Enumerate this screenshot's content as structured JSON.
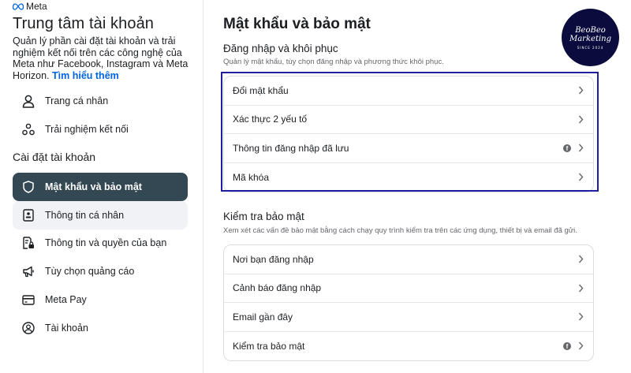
{
  "brand": {
    "name": "Meta",
    "logo_color": "#0064e0"
  },
  "sidebar": {
    "title": "Trung tâm tài khoản",
    "description": "Quản lý phần cài đặt tài khoản và trải nghiệm kết nối trên các công nghệ của Meta như Facebook, Instagram và Meta Horizon.",
    "learn_more": "Tìm hiểu thêm",
    "top_items": [
      {
        "label": "Trang cá nhân",
        "icon": "person-icon"
      },
      {
        "label": "Trải nghiệm kết nối",
        "icon": "connected-icon"
      }
    ],
    "section_label": "Cài đặt tài khoản",
    "settings_items": [
      {
        "label": "Mật khẩu và bảo mật",
        "icon": "shield-icon",
        "active": true
      },
      {
        "label": "Thông tin cá nhân",
        "icon": "id-card-icon"
      },
      {
        "label": "Thông tin và quyền của bạn",
        "icon": "document-lock-icon"
      },
      {
        "label": "Tùy chọn quảng cáo",
        "icon": "megaphone-icon"
      },
      {
        "label": "Meta Pay",
        "icon": "credit-card-icon"
      },
      {
        "label": "Tài khoản",
        "icon": "account-circle-icon"
      }
    ],
    "active_bg": "#344854"
  },
  "main": {
    "title": "Mật khẩu và bảo mật",
    "login_group": {
      "title": "Đăng nhập và khôi phục",
      "description": "Quản lý mật khẩu, tùy chọn đăng nhập và phương thức khôi phục.",
      "rows": [
        {
          "label": "Đổi mật khẩu"
        },
        {
          "label": "Xác thực 2 yếu tố"
        },
        {
          "label": "Thông tin đăng nhập đã lưu",
          "facebook_icon": true
        },
        {
          "label": "Mã khóa"
        }
      ]
    },
    "security_group": {
      "title": "Kiểm tra bảo mật",
      "description": "Xem xét các vấn đề bảo mật bằng cách chạy quy trình kiểm tra trên các ứng dụng, thiết bị và email đã gửi.",
      "rows": [
        {
          "label": "Nơi bạn đăng nhập"
        },
        {
          "label": "Cảnh báo đăng nhập"
        },
        {
          "label": "Email gần đây"
        },
        {
          "label": "Kiểm tra bảo mật",
          "facebook_icon": true
        }
      ]
    }
  },
  "watermark": {
    "line1": "BeoBeo",
    "line2": "Marketing",
    "line3": "SINCE 2024",
    "bg": "#0b0c3d"
  },
  "highlight_color": "#1f1ea0"
}
